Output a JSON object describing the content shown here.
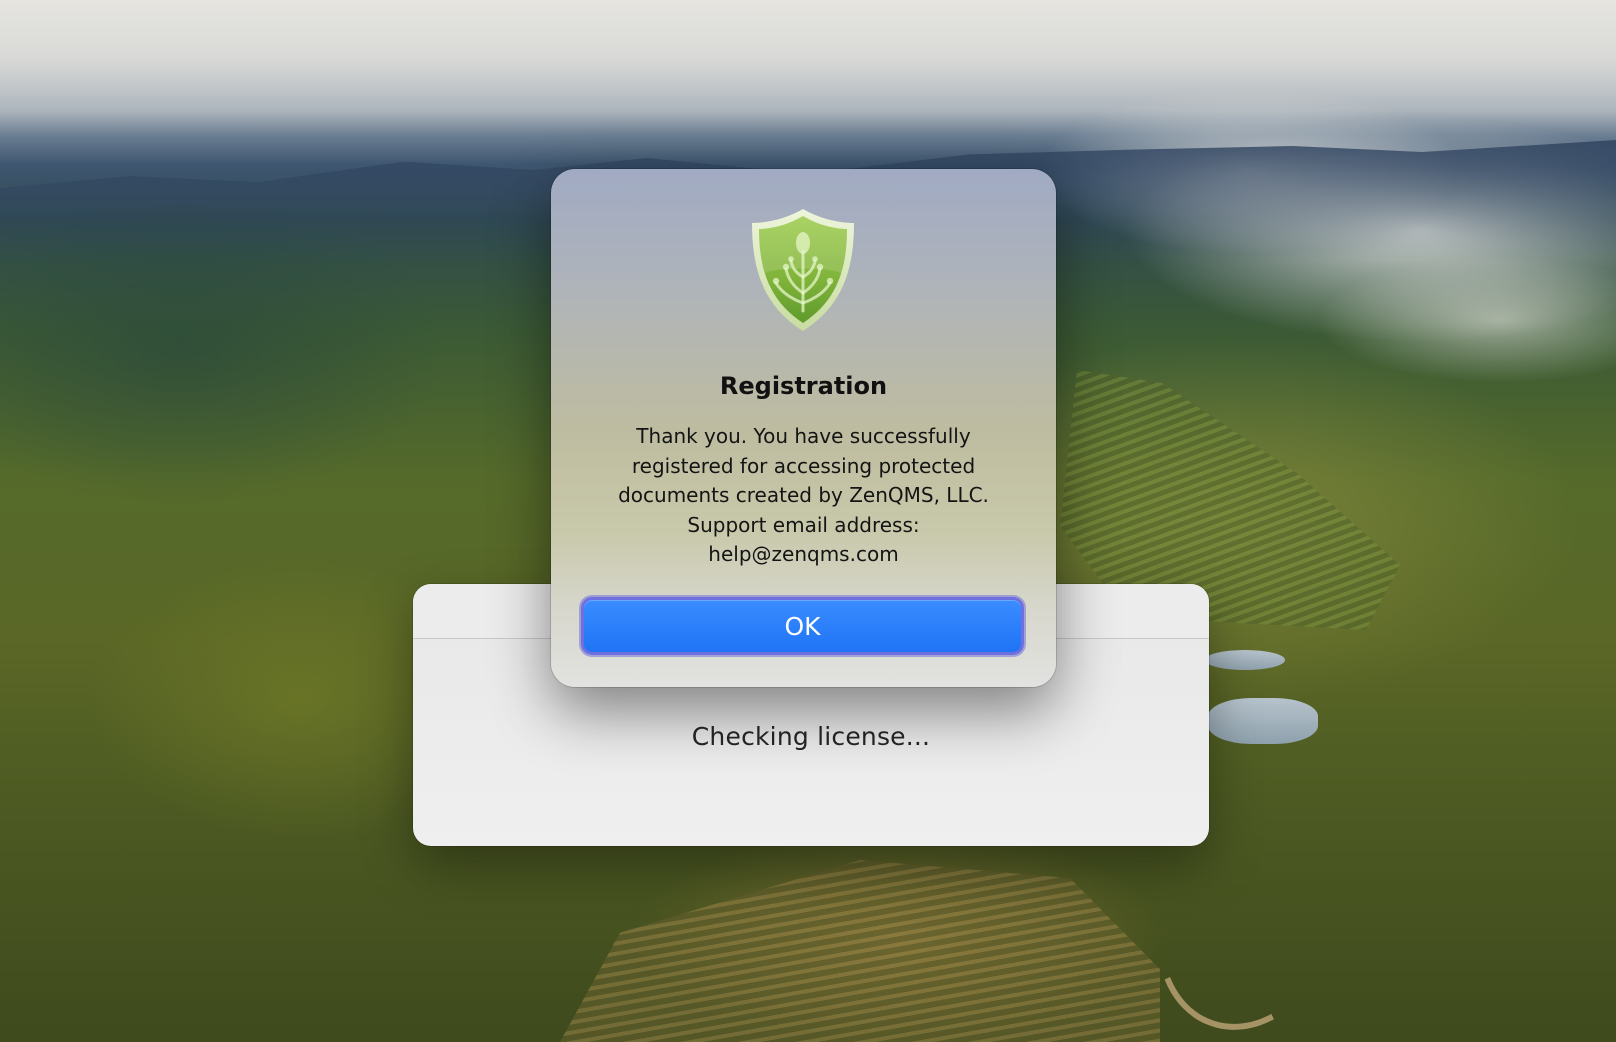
{
  "desktop": {
    "wallpaper": "misty forest hills with vineyards"
  },
  "license_window": {
    "status_text": "Checking license..."
  },
  "alert": {
    "icon": "shield-icon",
    "icon_color": "#8ab83a",
    "title": "Registration",
    "message": "Thank you. You have successfully\nregistered for accessing protected\ndocuments created by ZenQMS, LLC.\nSupport email address:\nhelp@zenqms.com",
    "ok_label": "OK",
    "accent_color": "#1f74f5"
  }
}
